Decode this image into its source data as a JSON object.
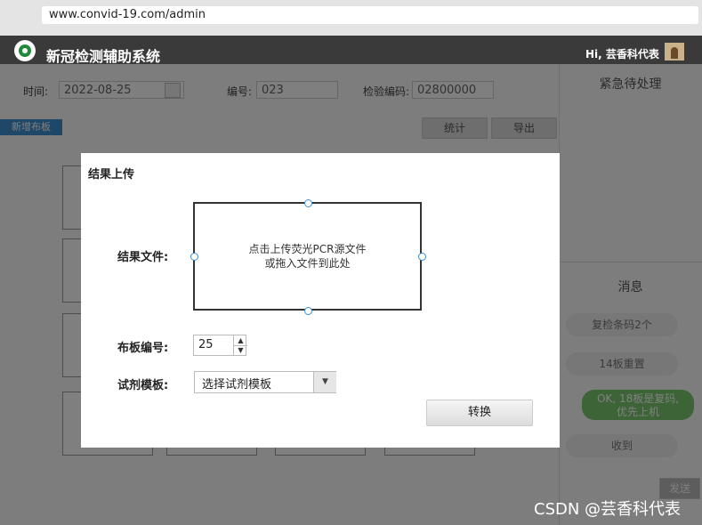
{
  "browser": {
    "url": "www.convid-19.com/admin"
  },
  "app": {
    "title": "新冠检测辅助系统",
    "greeting": "Hi, 芸香科代表"
  },
  "filters": {
    "time_label": "时间:",
    "time_value": "2022-08-25",
    "number_label": "编号:",
    "number_value": "023",
    "barcode_label": "检验编码:",
    "barcode_value": "02800000"
  },
  "toolbar": {
    "new_board": "新增布板",
    "stats": "统计",
    "export": "导出"
  },
  "right_panel": {
    "urgent_title": "紧急待处理",
    "messages_title": "消息",
    "messages": [
      "复检条码2个",
      "14板重置",
      "OK, 18板是复码,\n优先上机",
      "收到"
    ],
    "send_button": "发送"
  },
  "modal": {
    "title": "结果上传",
    "file_label": "结果文件:",
    "drop_line1": "点击上传荧光PCR源文件",
    "drop_line2": "或拖入文件到此处",
    "board_label": "布板编号:",
    "board_value": "25",
    "reagent_label": "试剂模板:",
    "reagent_value": "选择试剂模板",
    "convert_button": "转换"
  },
  "watermark": "CSDN @芸香科代表"
}
